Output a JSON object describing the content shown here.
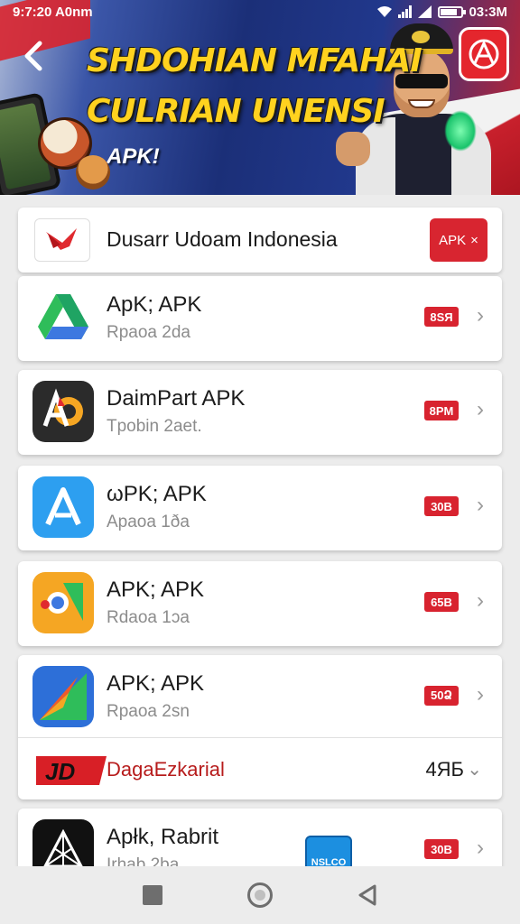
{
  "status_bar": {
    "time": "9:7:20 A0nm",
    "clock_right": "03:3M"
  },
  "banner": {
    "headline_line1": "SHDOHIAN MFAHAI",
    "headline_line2": "CULRIAN UNENSI",
    "tag": "APK!",
    "colors": {
      "headline": "#ffd21f",
      "brand_red": "#e4262d"
    }
  },
  "featured": {
    "name": "Dusarr Udoam Indonesia",
    "pill_label": "APK",
    "pill_close": "×"
  },
  "apps": [
    {
      "title": "ApK; APK",
      "subtitle": "Rpaoa 2da",
      "size": "8SЯ",
      "icon": "google-drive-style-icon"
    },
    {
      "title": "DaimPart APK",
      "subtitle": "Tpobin 2aet.",
      "size": "8PM",
      "icon": "ad-logo-icon"
    },
    {
      "title": "ωPK; APK",
      "subtitle": "Apaoa 1ða",
      "size": "30B",
      "icon": "blue-a-icon"
    },
    {
      "title": "APK; APK",
      "subtitle": "Rdaoa 1ɔa",
      "size": "65B",
      "icon": "orange-camera-icon"
    },
    {
      "title": "APK; APK",
      "subtitle": "Rpaoa 2sn",
      "size": "50Ձ",
      "icon": "red-arrow-icon"
    }
  ],
  "ad_row": {
    "name": "DagaEzkarial",
    "number": "4ЯБ",
    "logo_text": "JD"
  },
  "last_item": {
    "title": "Apłk, Rabrit",
    "subtitle": "Irhab 2ba",
    "size": "30B",
    "badge_text": "NSLCO"
  },
  "chevron": "›",
  "nav": [
    "square-recents-button",
    "circle-home-button",
    "triangle-back-button"
  ]
}
